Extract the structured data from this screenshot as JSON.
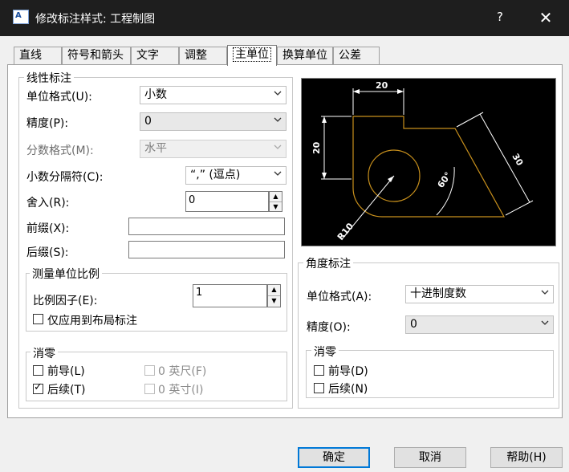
{
  "window": {
    "title": "修改标注样式: 工程制图",
    "help": "?",
    "close": "✕",
    "icon_text": "A"
  },
  "tabs": [
    {
      "label": "直线"
    },
    {
      "label": "符号和箭头"
    },
    {
      "label": "文字"
    },
    {
      "label": "调整"
    },
    {
      "label": "主单位",
      "active": true
    },
    {
      "label": "换算单位"
    },
    {
      "label": "公差"
    }
  ],
  "linear": {
    "legend": "线性标注",
    "unit_format_label": "单位格式(U):",
    "unit_format_value": "小数",
    "precision_label": "精度(P):",
    "precision_value": "0",
    "fraction_label": "分数格式(M):",
    "fraction_value": "水平",
    "decimal_sep_label": "小数分隔符(C):",
    "decimal_sep_value": "“,”  (逗点)",
    "roundoff_label": "舍入(R):",
    "roundoff_value": "0",
    "prefix_label": "前缀(X):",
    "prefix_value": "",
    "suffix_label": "后缀(S):",
    "suffix_value": ""
  },
  "scale": {
    "legend": "测量单位比例",
    "factor_label": "比例因子(E):",
    "factor_value": "1",
    "layout_only_label": "仅应用到布局标注"
  },
  "zero_linear": {
    "legend": "消零",
    "leading_label": "前导(L)",
    "trailing_label": "后续(T)",
    "feet_label": "0 英尺(F)",
    "inches_label": "0 英寸(I)"
  },
  "angular": {
    "legend": "角度标注",
    "unit_format_label": "单位格式(A):",
    "unit_format_value": "十进制度数",
    "precision_label": "精度(O):",
    "precision_value": "0"
  },
  "zero_angular": {
    "legend": "消零",
    "leading_label": "前导(D)",
    "trailing_label": "后续(N)"
  },
  "preview": {
    "dim_top": "20",
    "dim_left": "20",
    "dim_right": "30",
    "dim_angle": "60°",
    "dim_radius": "R10"
  },
  "buttons": {
    "ok": "确定",
    "cancel": "取消",
    "help": "帮助(H)"
  },
  "colors": {
    "accent": "#0078d7",
    "preview_bg": "#000000",
    "preview_geometry": "#c8901c",
    "preview_dims": "#ffffff"
  }
}
